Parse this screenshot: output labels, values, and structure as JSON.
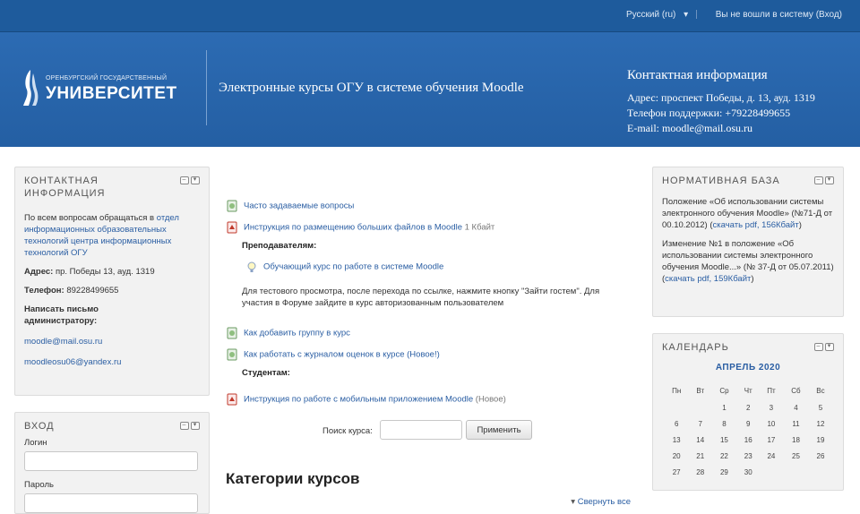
{
  "topbar": {
    "language": "Русский (ru)",
    "language_caret": "▾",
    "login_status": "Вы не вошли в систему (Вход)"
  },
  "header": {
    "logo_small": "ОРЕНБУРГСКИЙ ГОСУДАРСТВЕННЫЙ",
    "logo_big": "УНИВЕРСИТЕТ",
    "site_name": "Электронные курсы ОГУ в системе обучения Moodle",
    "contacts_title": "Контактная информация",
    "address": "Адрес: проспект Победы, д. 13, ауд. 1319",
    "phone": "Телефон поддержки: +79228499655",
    "email": "E-mail: moodle@mail.osu.ru"
  },
  "block_contact": {
    "title": "Контактная информация",
    "intro_text": "По всем вопросам обращаться в ",
    "intro_link": "отдел информационных образовательных технологий центра информационных технологий ОГУ",
    "address_label": "Адрес:",
    "address_value": " пр. Победы 13, ауд. 1319",
    "phone_label": "Телефон:",
    "phone_value": " 89228499655",
    "write_label": "Написать письмо администратору:",
    "email1": "moodle@mail.osu.ru",
    "email2": "moodleosu06@yandex.ru"
  },
  "block_login": {
    "title": "Вход",
    "login_label": "Логин",
    "password_label": "Пароль"
  },
  "main": {
    "faq": "Часто задаваемые вопросы",
    "large_files": "Инструкция по размещению больших файлов в Moodle",
    "large_files_suffix": " 1 Кбайт",
    "teachers_heading": "Преподавателям:",
    "training_course": "Обучающий курс по работе в системе Moodle",
    "preview_line1": "Для тестового просмотра, после перехода по ссылке, нажмите кнопку \"Зайти гостем\". Для участия в Форуме зайдите в курс авторизованным пользователем",
    "add_group": "Как добавить группу в курс",
    "gradebook": "Как работать с журналом оценок в курсе (Новое!)",
    "students_heading": "Студентам:",
    "mobile_app": "Инструкция по работе с мобильным приложением Moodle",
    "mobile_app_suffix": " (Новое)",
    "search_label": "Поиск курса:",
    "search_button": "Применить",
    "categories_title": "Категории курсов",
    "collapse_all": "Свернуть все"
  },
  "block_norm": {
    "title": "Нормативная база",
    "item1_text": "Положение «Об использовании системы электронного обучения Moodle» (№71-Д от 00.10.2012)",
    "item1_link": "скачать pdf, 156Кбайт",
    "item2_text": "Изменение №1 в положение «Об использовании системы электронного обучения Moodle...» (№ 37-Д от 05.07.2011)",
    "item2_link": "скачать pdf, 159Кбайт"
  },
  "block_cal": {
    "title": "Календарь",
    "month": "АПРЕЛЬ 2020",
    "weekdays": [
      "Пн",
      "Вт",
      "Ср",
      "Чт",
      "Пт",
      "Сб",
      "Вс"
    ],
    "weeks": [
      [
        "",
        "",
        "1",
        "2",
        "3",
        "4",
        "5"
      ],
      [
        "6",
        "7",
        "8",
        "9",
        "10",
        "11",
        "12"
      ],
      [
        "13",
        "14",
        "15",
        "16",
        "17",
        "18",
        "19"
      ],
      [
        "20",
        "21",
        "22",
        "23",
        "24",
        "25",
        "26"
      ],
      [
        "27",
        "28",
        "29",
        "30",
        "",
        "",
        ""
      ]
    ]
  },
  "colors": {
    "brand_blue": "#2c6bb3",
    "link_blue": "#2a5ea3",
    "pdf_red": "#c0392b"
  },
  "icons": [
    "university-logo-icon",
    "page-icon",
    "pdf-icon",
    "bulb-icon",
    "hide-block-icon",
    "move-block-icon",
    "triangle-down-icon"
  ]
}
